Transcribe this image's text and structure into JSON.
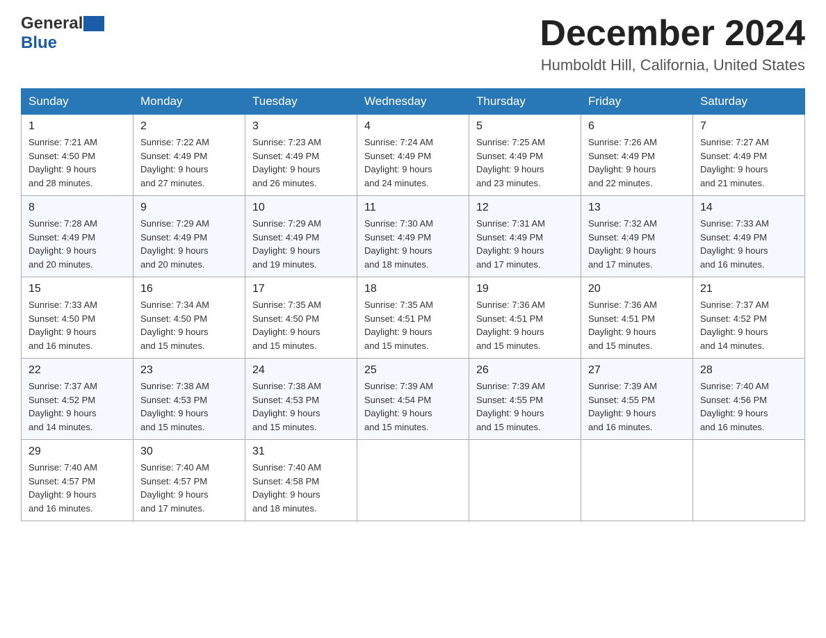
{
  "header": {
    "logo_general": "General",
    "logo_blue": "Blue",
    "month_title": "December 2024",
    "location": "Humboldt Hill, California, United States"
  },
  "weekdays": [
    "Sunday",
    "Monday",
    "Tuesday",
    "Wednesday",
    "Thursday",
    "Friday",
    "Saturday"
  ],
  "weeks": [
    [
      {
        "day": "1",
        "sunrise": "Sunrise: 7:21 AM",
        "sunset": "Sunset: 4:50 PM",
        "daylight": "Daylight: 9 hours",
        "daylight2": "and 28 minutes."
      },
      {
        "day": "2",
        "sunrise": "Sunrise: 7:22 AM",
        "sunset": "Sunset: 4:49 PM",
        "daylight": "Daylight: 9 hours",
        "daylight2": "and 27 minutes."
      },
      {
        "day": "3",
        "sunrise": "Sunrise: 7:23 AM",
        "sunset": "Sunset: 4:49 PM",
        "daylight": "Daylight: 9 hours",
        "daylight2": "and 26 minutes."
      },
      {
        "day": "4",
        "sunrise": "Sunrise: 7:24 AM",
        "sunset": "Sunset: 4:49 PM",
        "daylight": "Daylight: 9 hours",
        "daylight2": "and 24 minutes."
      },
      {
        "day": "5",
        "sunrise": "Sunrise: 7:25 AM",
        "sunset": "Sunset: 4:49 PM",
        "daylight": "Daylight: 9 hours",
        "daylight2": "and 23 minutes."
      },
      {
        "day": "6",
        "sunrise": "Sunrise: 7:26 AM",
        "sunset": "Sunset: 4:49 PM",
        "daylight": "Daylight: 9 hours",
        "daylight2": "and 22 minutes."
      },
      {
        "day": "7",
        "sunrise": "Sunrise: 7:27 AM",
        "sunset": "Sunset: 4:49 PM",
        "daylight": "Daylight: 9 hours",
        "daylight2": "and 21 minutes."
      }
    ],
    [
      {
        "day": "8",
        "sunrise": "Sunrise: 7:28 AM",
        "sunset": "Sunset: 4:49 PM",
        "daylight": "Daylight: 9 hours",
        "daylight2": "and 20 minutes."
      },
      {
        "day": "9",
        "sunrise": "Sunrise: 7:29 AM",
        "sunset": "Sunset: 4:49 PM",
        "daylight": "Daylight: 9 hours",
        "daylight2": "and 20 minutes."
      },
      {
        "day": "10",
        "sunrise": "Sunrise: 7:29 AM",
        "sunset": "Sunset: 4:49 PM",
        "daylight": "Daylight: 9 hours",
        "daylight2": "and 19 minutes."
      },
      {
        "day": "11",
        "sunrise": "Sunrise: 7:30 AM",
        "sunset": "Sunset: 4:49 PM",
        "daylight": "Daylight: 9 hours",
        "daylight2": "and 18 minutes."
      },
      {
        "day": "12",
        "sunrise": "Sunrise: 7:31 AM",
        "sunset": "Sunset: 4:49 PM",
        "daylight": "Daylight: 9 hours",
        "daylight2": "and 17 minutes."
      },
      {
        "day": "13",
        "sunrise": "Sunrise: 7:32 AM",
        "sunset": "Sunset: 4:49 PM",
        "daylight": "Daylight: 9 hours",
        "daylight2": "and 17 minutes."
      },
      {
        "day": "14",
        "sunrise": "Sunrise: 7:33 AM",
        "sunset": "Sunset: 4:49 PM",
        "daylight": "Daylight: 9 hours",
        "daylight2": "and 16 minutes."
      }
    ],
    [
      {
        "day": "15",
        "sunrise": "Sunrise: 7:33 AM",
        "sunset": "Sunset: 4:50 PM",
        "daylight": "Daylight: 9 hours",
        "daylight2": "and 16 minutes."
      },
      {
        "day": "16",
        "sunrise": "Sunrise: 7:34 AM",
        "sunset": "Sunset: 4:50 PM",
        "daylight": "Daylight: 9 hours",
        "daylight2": "and 15 minutes."
      },
      {
        "day": "17",
        "sunrise": "Sunrise: 7:35 AM",
        "sunset": "Sunset: 4:50 PM",
        "daylight": "Daylight: 9 hours",
        "daylight2": "and 15 minutes."
      },
      {
        "day": "18",
        "sunrise": "Sunrise: 7:35 AM",
        "sunset": "Sunset: 4:51 PM",
        "daylight": "Daylight: 9 hours",
        "daylight2": "and 15 minutes."
      },
      {
        "day": "19",
        "sunrise": "Sunrise: 7:36 AM",
        "sunset": "Sunset: 4:51 PM",
        "daylight": "Daylight: 9 hours",
        "daylight2": "and 15 minutes."
      },
      {
        "day": "20",
        "sunrise": "Sunrise: 7:36 AM",
        "sunset": "Sunset: 4:51 PM",
        "daylight": "Daylight: 9 hours",
        "daylight2": "and 15 minutes."
      },
      {
        "day": "21",
        "sunrise": "Sunrise: 7:37 AM",
        "sunset": "Sunset: 4:52 PM",
        "daylight": "Daylight: 9 hours",
        "daylight2": "and 14 minutes."
      }
    ],
    [
      {
        "day": "22",
        "sunrise": "Sunrise: 7:37 AM",
        "sunset": "Sunset: 4:52 PM",
        "daylight": "Daylight: 9 hours",
        "daylight2": "and 14 minutes."
      },
      {
        "day": "23",
        "sunrise": "Sunrise: 7:38 AM",
        "sunset": "Sunset: 4:53 PM",
        "daylight": "Daylight: 9 hours",
        "daylight2": "and 15 minutes."
      },
      {
        "day": "24",
        "sunrise": "Sunrise: 7:38 AM",
        "sunset": "Sunset: 4:53 PM",
        "daylight": "Daylight: 9 hours",
        "daylight2": "and 15 minutes."
      },
      {
        "day": "25",
        "sunrise": "Sunrise: 7:39 AM",
        "sunset": "Sunset: 4:54 PM",
        "daylight": "Daylight: 9 hours",
        "daylight2": "and 15 minutes."
      },
      {
        "day": "26",
        "sunrise": "Sunrise: 7:39 AM",
        "sunset": "Sunset: 4:55 PM",
        "daylight": "Daylight: 9 hours",
        "daylight2": "and 15 minutes."
      },
      {
        "day": "27",
        "sunrise": "Sunrise: 7:39 AM",
        "sunset": "Sunset: 4:55 PM",
        "daylight": "Daylight: 9 hours",
        "daylight2": "and 16 minutes."
      },
      {
        "day": "28",
        "sunrise": "Sunrise: 7:40 AM",
        "sunset": "Sunset: 4:56 PM",
        "daylight": "Daylight: 9 hours",
        "daylight2": "and 16 minutes."
      }
    ],
    [
      {
        "day": "29",
        "sunrise": "Sunrise: 7:40 AM",
        "sunset": "Sunset: 4:57 PM",
        "daylight": "Daylight: 9 hours",
        "daylight2": "and 16 minutes."
      },
      {
        "day": "30",
        "sunrise": "Sunrise: 7:40 AM",
        "sunset": "Sunset: 4:57 PM",
        "daylight": "Daylight: 9 hours",
        "daylight2": "and 17 minutes."
      },
      {
        "day": "31",
        "sunrise": "Sunrise: 7:40 AM",
        "sunset": "Sunset: 4:58 PM",
        "daylight": "Daylight: 9 hours",
        "daylight2": "and 18 minutes."
      },
      null,
      null,
      null,
      null
    ]
  ]
}
